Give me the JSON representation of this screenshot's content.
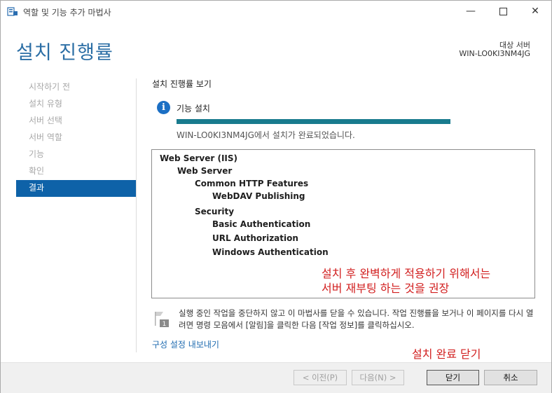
{
  "window": {
    "title": "역할 및 기능 추가 마법사"
  },
  "header": {
    "page_title": "설치 진행률",
    "dest_label": "대상 서버",
    "dest_server": "WIN-LO0KI3NM4JG"
  },
  "nav": {
    "items": [
      {
        "label": "시작하기 전",
        "active": false
      },
      {
        "label": "설치 유형",
        "active": false
      },
      {
        "label": "서버 선택",
        "active": false
      },
      {
        "label": "서버 역할",
        "active": false
      },
      {
        "label": "기능",
        "active": false
      },
      {
        "label": "확인",
        "active": false
      },
      {
        "label": "결과",
        "active": true
      }
    ]
  },
  "main": {
    "section_title": "설치 진행률 보기",
    "status_label": "기능 설치",
    "progress_fraction": 1.0,
    "progress_color": "#197b8e",
    "success_message": "WIN-LO0KI3NM4JG에서 설치가 완료되었습니다.",
    "tree": [
      {
        "label": "Web Server (IIS)",
        "level": 0
      },
      {
        "label": "Web Server",
        "level": 1
      },
      {
        "label": "Common HTTP Features",
        "level": 2
      },
      {
        "label": "WebDAV Publishing",
        "level": 3
      },
      {
        "label": "Security",
        "level": 2
      },
      {
        "label": "Basic Authentication",
        "level": 3
      },
      {
        "label": "URL Authorization",
        "level": 3
      },
      {
        "label": "Windows Authentication",
        "level": 3
      }
    ],
    "red_note_line1": "설치 후 완벽하게 적용하기 위해서는",
    "red_note_line2": "서버 재부팅 하는 것을 권장",
    "warning_text": "실행 중인 작업을 중단하지 않고 이 마법사를 닫을 수 있습니다. 작업 진행률을 보거나 이 페이지를 다시 열려면 명령 모음에서 [알림]을 클릭한 다음 [작업 정보]를 클릭하십시오.",
    "export_link": "구성 설정 내보내기",
    "red_close_note": "설치 완료 닫기"
  },
  "footer": {
    "prev": "< 이전(P)",
    "next": "다음(N) >",
    "close": "닫기",
    "cancel": "취소"
  },
  "colors": {
    "accent": "#0e62a8",
    "title": "#2b6ea5",
    "annotation": "#d22020"
  }
}
